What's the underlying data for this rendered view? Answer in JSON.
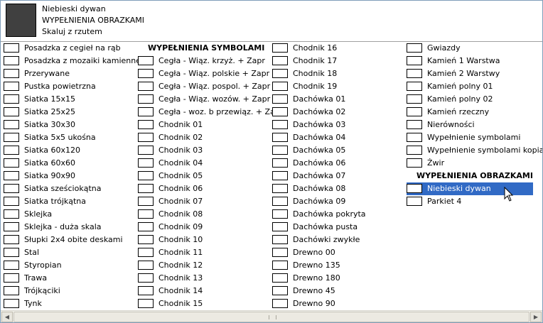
{
  "header": {
    "name": "Niebieski dywan",
    "category": "WYPEŁNIENIA OBRAZKAMI",
    "mode": "Skaluj z rzutem"
  },
  "columns": [
    [
      {
        "label": "Posadzka z cegieł na rąb",
        "pattern": "brick"
      },
      {
        "label": "Posadzka z mozaiki kamiennej",
        "pattern": "mosaic"
      },
      {
        "label": "Przerywane",
        "pattern": "diag"
      },
      {
        "label": "Pustka powietrzna",
        "pattern": "blank"
      },
      {
        "label": "Siatka 15x15",
        "pattern": "grid"
      },
      {
        "label": "Siatka 25x25",
        "pattern": "grid"
      },
      {
        "label": "Siatka 30x30",
        "pattern": "grid"
      },
      {
        "label": "Siatka 5x5 ukośna",
        "pattern": "x"
      },
      {
        "label": "Siatka 60x120",
        "pattern": "grid"
      },
      {
        "label": "Siatka 60x60",
        "pattern": "grid"
      },
      {
        "label": "Siatka 90x90",
        "pattern": "grid"
      },
      {
        "label": "Siatka sześciokątna",
        "pattern": "hex"
      },
      {
        "label": "Siatka trójkątna",
        "pattern": "tri"
      },
      {
        "label": "Sklejka",
        "pattern": "hl"
      },
      {
        "label": "Sklejka - duża skala",
        "pattern": "hl"
      },
      {
        "label": "Słupki 2x4 obite deskami",
        "pattern": "plank"
      },
      {
        "label": "Stal",
        "pattern": "diag"
      },
      {
        "label": "Styropian",
        "pattern": "wave"
      },
      {
        "label": "Trawa",
        "pattern": "dots"
      },
      {
        "label": "Trójkąciki",
        "pattern": "tri"
      },
      {
        "label": "Tynk",
        "pattern": "dense"
      }
    ],
    [
      {
        "label": "WYPEŁNIENIA SYMBOLAMI",
        "header": true
      },
      {
        "label": "Cegła - Wiąz. krzyż. + Zapr",
        "pattern": "brick"
      },
      {
        "label": "Cegła - Wiąz. polskie + Zapr",
        "pattern": "brick"
      },
      {
        "label": "Cegła - Wiąz. pospol. + Zapr",
        "pattern": "brick"
      },
      {
        "label": "Cegła - Wiąz. wozów. + Zapr",
        "pattern": "brick"
      },
      {
        "label": "Cegła - woz. b przewiąz. + Zapr",
        "pattern": "brick"
      },
      {
        "label": "Chodnik 01",
        "pattern": "mosaic"
      },
      {
        "label": "Chodnik 02",
        "pattern": "x"
      },
      {
        "label": "Chodnik 03",
        "pattern": "dense"
      },
      {
        "label": "Chodnik 04",
        "pattern": "hex"
      },
      {
        "label": "Chodnik 05",
        "pattern": "grid"
      },
      {
        "label": "Chodnik 06",
        "pattern": "gridf"
      },
      {
        "label": "Chodnik 07",
        "pattern": "x"
      },
      {
        "label": "Chodnik 08",
        "pattern": "brick"
      },
      {
        "label": "Chodnik 09",
        "pattern": "mosaic"
      },
      {
        "label": "Chodnik 10",
        "pattern": "x"
      },
      {
        "label": "Chodnik 11",
        "pattern": "gridf"
      },
      {
        "label": "Chodnik 12",
        "pattern": "hex"
      },
      {
        "label": "Chodnik 13",
        "pattern": "mosaic"
      },
      {
        "label": "Chodnik 14",
        "pattern": "x"
      },
      {
        "label": "Chodnik 15",
        "pattern": "dense"
      }
    ],
    [
      {
        "label": "Chodnik 16",
        "pattern": "mosaic"
      },
      {
        "label": "Chodnik 17",
        "pattern": "vl"
      },
      {
        "label": "Chodnik 18",
        "pattern": "wave"
      },
      {
        "label": "Chodnik 19",
        "pattern": "wave"
      },
      {
        "label": "Dachówka 01",
        "pattern": "roof"
      },
      {
        "label": "Dachówka 02",
        "pattern": "diag2"
      },
      {
        "label": "Dachówka 03",
        "pattern": "wave"
      },
      {
        "label": "Dachówka 04",
        "pattern": "diag"
      },
      {
        "label": "Dachówka 05",
        "pattern": "diag"
      },
      {
        "label": "Dachówka 06",
        "pattern": "diag2"
      },
      {
        "label": "Dachówka 07",
        "pattern": "vl"
      },
      {
        "label": "Dachówka 08",
        "pattern": "roof"
      },
      {
        "label": "Dachówka 09",
        "pattern": "x"
      },
      {
        "label": "Dachówka pokryta",
        "pattern": "roof"
      },
      {
        "label": "Dachówka pusta",
        "pattern": "roof"
      },
      {
        "label": "Dachówki zwykłe",
        "pattern": "roof"
      },
      {
        "label": "Drewno 00",
        "pattern": "wave"
      },
      {
        "label": "Drewno 135",
        "pattern": "diag2"
      },
      {
        "label": "Drewno 180",
        "pattern": "wave"
      },
      {
        "label": "Drewno 45",
        "pattern": "diag"
      },
      {
        "label": "Drewno 90",
        "pattern": "vl"
      }
    ],
    [
      {
        "label": "Gwiazdy",
        "pattern": "mosaic"
      },
      {
        "label": "Kamień 1 Warstwa",
        "pattern": "brick"
      },
      {
        "label": "Kamień 2 Warstwy",
        "pattern": "brick"
      },
      {
        "label": "Kamień polny 01",
        "pattern": "hex"
      },
      {
        "label": "Kamień polny 02",
        "pattern": "hex"
      },
      {
        "label": "Kamień rzeczny",
        "pattern": "mosaic"
      },
      {
        "label": "Nierówności",
        "pattern": "vl"
      },
      {
        "label": "Wypełnienie symbolami",
        "pattern": "x"
      },
      {
        "label": "Wypełnienie symbolami kopia",
        "pattern": "x"
      },
      {
        "label": "Żwir",
        "pattern": "dots"
      },
      {
        "label": "WYPEŁNIENIA OBRAZKAMI",
        "header": true
      },
      {
        "label": "Niebieski dywan",
        "pattern": "dense",
        "selected": true
      },
      {
        "label": "Parkiet 4",
        "pattern": "brick"
      }
    ]
  ]
}
